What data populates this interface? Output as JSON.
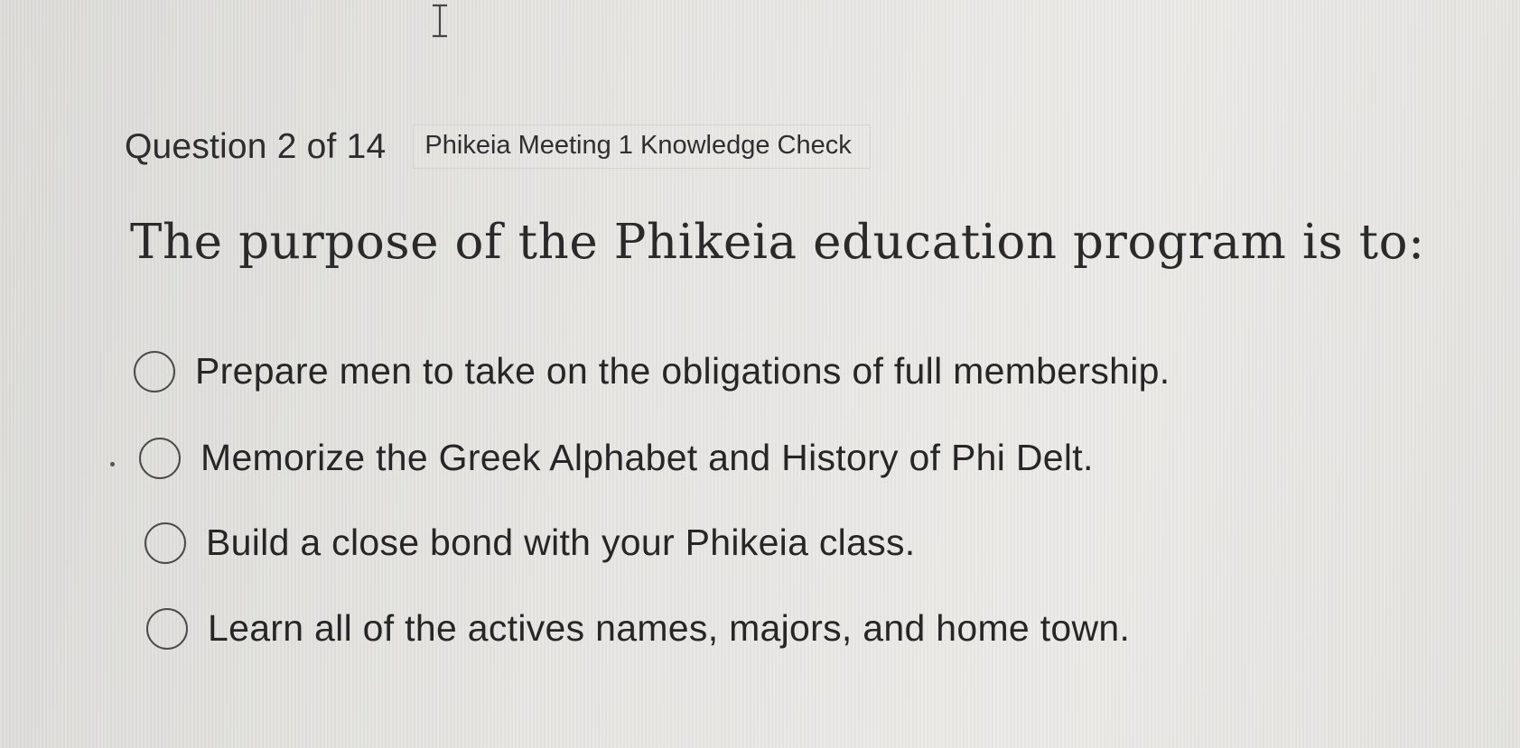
{
  "header": {
    "question_count": "Question 2 of 14",
    "quiz_title": "Phikeia Meeting 1 Knowledge Check"
  },
  "question": {
    "prompt": "The purpose of the Phikeia education program is to:"
  },
  "options": [
    {
      "label": "Prepare men to take on the obligations of full membership.",
      "selected": false
    },
    {
      "label": "Memorize the Greek Alphabet and History of Phi Delt.",
      "selected": false
    },
    {
      "label": "Build a close bond with your Phikeia class.",
      "selected": false
    },
    {
      "label": "Learn all of the actives names, majors, and home town.",
      "selected": false
    }
  ],
  "icons": {
    "cursor": "text-cursor-icon",
    "radio": "radio-button-icon"
  },
  "colors": {
    "background": "#e2e1de",
    "text": "#2b2b2b",
    "radio_border": "#4a4a4a"
  }
}
